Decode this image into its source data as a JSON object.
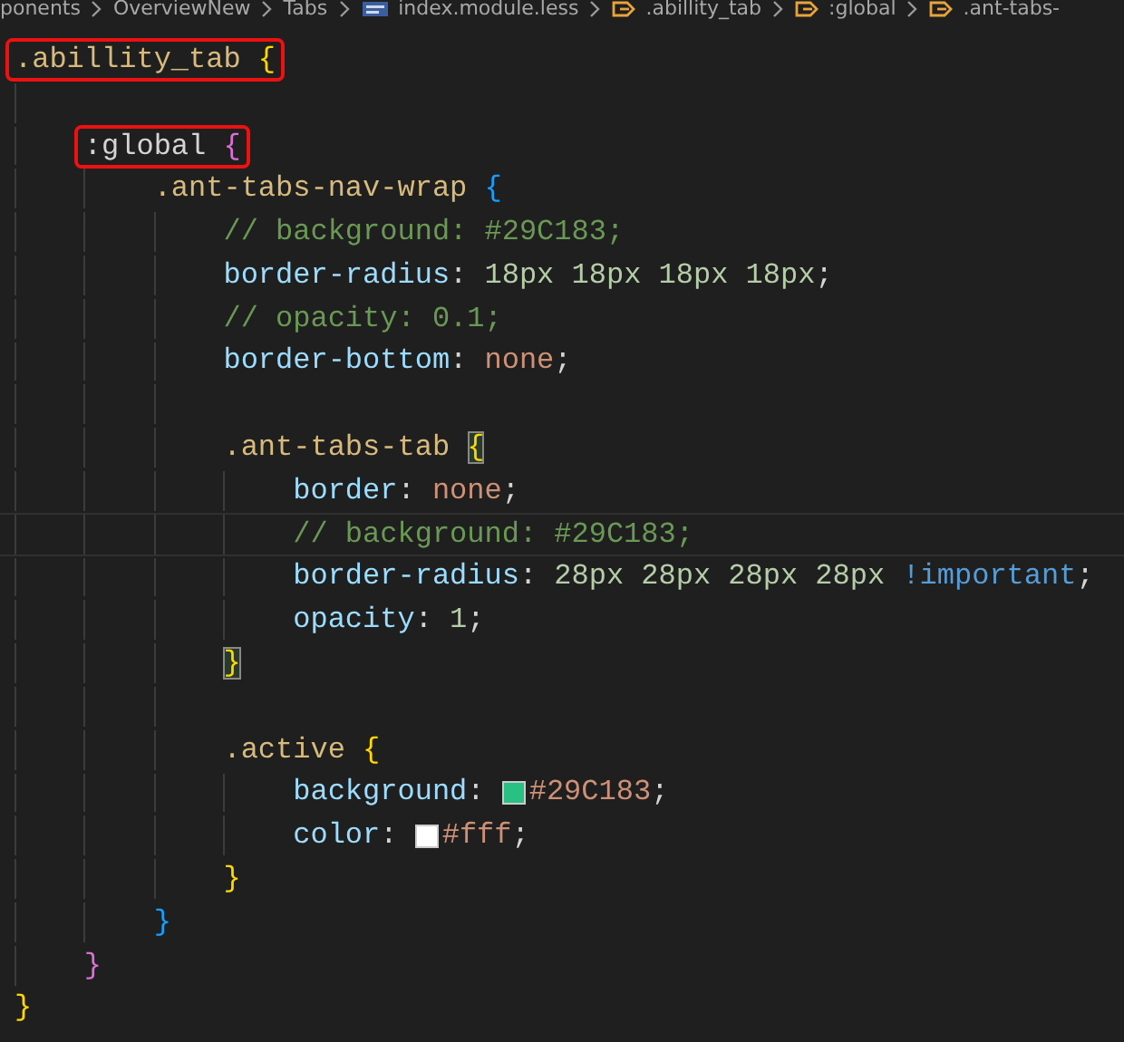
{
  "breadcrumb": [
    {
      "text": "ponents",
      "kind": "folder"
    },
    {
      "text": "OverviewNew",
      "kind": "folder"
    },
    {
      "text": "Tabs",
      "kind": "folder"
    },
    {
      "text": "index.module.less",
      "kind": "file"
    },
    {
      "text": ".abillity_tab",
      "kind": "symbol"
    },
    {
      "text": ":global",
      "kind": "symbol"
    },
    {
      "text": ".ant-tabs-",
      "kind": "symbol"
    }
  ],
  "lines": [
    {
      "kind": "code",
      "outlined": true,
      "tokens": [
        {
          "kind": "selector",
          "text": ".abillity_tab"
        },
        {
          "kind": "brace",
          "text": "{",
          "color": "#ffd700"
        }
      ],
      "children": [
        {
          "kind": "blank"
        },
        {
          "kind": "code",
          "outlined": true,
          "tokens": [
            {
              "kind": "plain",
              "text": ":global"
            },
            {
              "kind": "brace",
              "text": "{",
              "color": "#da70d6"
            }
          ],
          "children": [
            {
              "kind": "code",
              "tokens": [
                {
                  "kind": "selector",
                  "text": ".ant-tabs-nav-wrap"
                },
                {
                  "kind": "brace",
                  "text": "{",
                  "color": "#179fff"
                }
              ],
              "children": [
                {
                  "kind": "code",
                  "tokens": [
                    {
                      "kind": "comment",
                      "text": "// background: #29C183;"
                    }
                  ]
                },
                {
                  "kind": "code",
                  "tokens": [
                    {
                      "kind": "property",
                      "text": "border-radius"
                    },
                    {
                      "kind": "plain",
                      "text": ": "
                    },
                    {
                      "kind": "number",
                      "text": "18px 18px 18px 18px"
                    },
                    {
                      "kind": "plain",
                      "text": ";"
                    }
                  ]
                },
                {
                  "kind": "code",
                  "tokens": [
                    {
                      "kind": "comment",
                      "text": "// opacity: 0.1;"
                    }
                  ]
                },
                {
                  "kind": "code",
                  "tokens": [
                    {
                      "kind": "property",
                      "text": "border-bottom"
                    },
                    {
                      "kind": "plain",
                      "text": ": "
                    },
                    {
                      "kind": "value",
                      "text": "none"
                    },
                    {
                      "kind": "plain",
                      "text": ";"
                    }
                  ]
                },
                {
                  "kind": "blank"
                },
                {
                  "kind": "code",
                  "tokens": [
                    {
                      "kind": "selector",
                      "text": ".ant-tabs-tab"
                    },
                    {
                      "kind": "brace",
                      "text": "{",
                      "color": "#ffd700",
                      "matched": true
                    }
                  ],
                  "children": [
                    {
                      "kind": "code",
                      "tokens": [
                        {
                          "kind": "property",
                          "text": "border"
                        },
                        {
                          "kind": "plain",
                          "text": ": "
                        },
                        {
                          "kind": "value",
                          "text": "none"
                        },
                        {
                          "kind": "plain",
                          "text": ";"
                        }
                      ]
                    },
                    {
                      "kind": "code",
                      "current": true,
                      "tokens": [
                        {
                          "kind": "comment",
                          "text": "// background: #29C183;"
                        }
                      ]
                    },
                    {
                      "kind": "code",
                      "tokens": [
                        {
                          "kind": "property",
                          "text": "border-radius"
                        },
                        {
                          "kind": "plain",
                          "text": ": "
                        },
                        {
                          "kind": "number",
                          "text": "28px 28px 28px 28px"
                        },
                        {
                          "kind": "keyword",
                          "text": "!important"
                        },
                        {
                          "kind": "plain",
                          "text": ";"
                        }
                      ]
                    },
                    {
                      "kind": "code",
                      "tokens": [
                        {
                          "kind": "property",
                          "text": "opacity"
                        },
                        {
                          "kind": "plain",
                          "text": ": "
                        },
                        {
                          "kind": "number",
                          "text": "1"
                        },
                        {
                          "kind": "plain",
                          "text": ";"
                        }
                      ]
                    }
                  ]
                },
                {
                  "kind": "code",
                  "tokens": [
                    {
                      "kind": "brace",
                      "text": "}",
                      "color": "#ffd700",
                      "matched": true
                    }
                  ]
                },
                {
                  "kind": "blank"
                },
                {
                  "kind": "code",
                  "tokens": [
                    {
                      "kind": "selector",
                      "text": ".active"
                    },
                    {
                      "kind": "brace",
                      "text": "{",
                      "color": "#ffd700"
                    }
                  ],
                  "children": [
                    {
                      "kind": "code",
                      "tokens": [
                        {
                          "kind": "property",
                          "text": "background"
                        },
                        {
                          "kind": "plain",
                          "text": ": "
                        },
                        {
                          "kind": "swatch",
                          "color": "#29c183"
                        },
                        {
                          "kind": "value",
                          "text": "#29C183"
                        },
                        {
                          "kind": "plain",
                          "text": ";"
                        }
                      ]
                    },
                    {
                      "kind": "code",
                      "tokens": [
                        {
                          "kind": "property",
                          "text": "color"
                        },
                        {
                          "kind": "plain",
                          "text": ": "
                        },
                        {
                          "kind": "swatch",
                          "color": "#ffffff"
                        },
                        {
                          "kind": "value",
                          "text": "#fff"
                        },
                        {
                          "kind": "plain",
                          "text": ";"
                        }
                      ]
                    }
                  ]
                },
                {
                  "kind": "code",
                  "tokens": [
                    {
                      "kind": "brace",
                      "text": "}",
                      "color": "#ffd700"
                    }
                  ]
                }
              ]
            },
            {
              "kind": "code",
              "tokens": [
                {
                  "kind": "brace",
                  "text": "}",
                  "color": "#179fff"
                }
              ]
            }
          ]
        },
        {
          "kind": "code",
          "tokens": [
            {
              "kind": "brace",
              "text": "}",
              "color": "#da70d6"
            }
          ]
        }
      ]
    },
    {
      "kind": "code",
      "tokens": [
        {
          "kind": "brace",
          "text": "}",
          "color": "#ffd700"
        }
      ]
    }
  ]
}
